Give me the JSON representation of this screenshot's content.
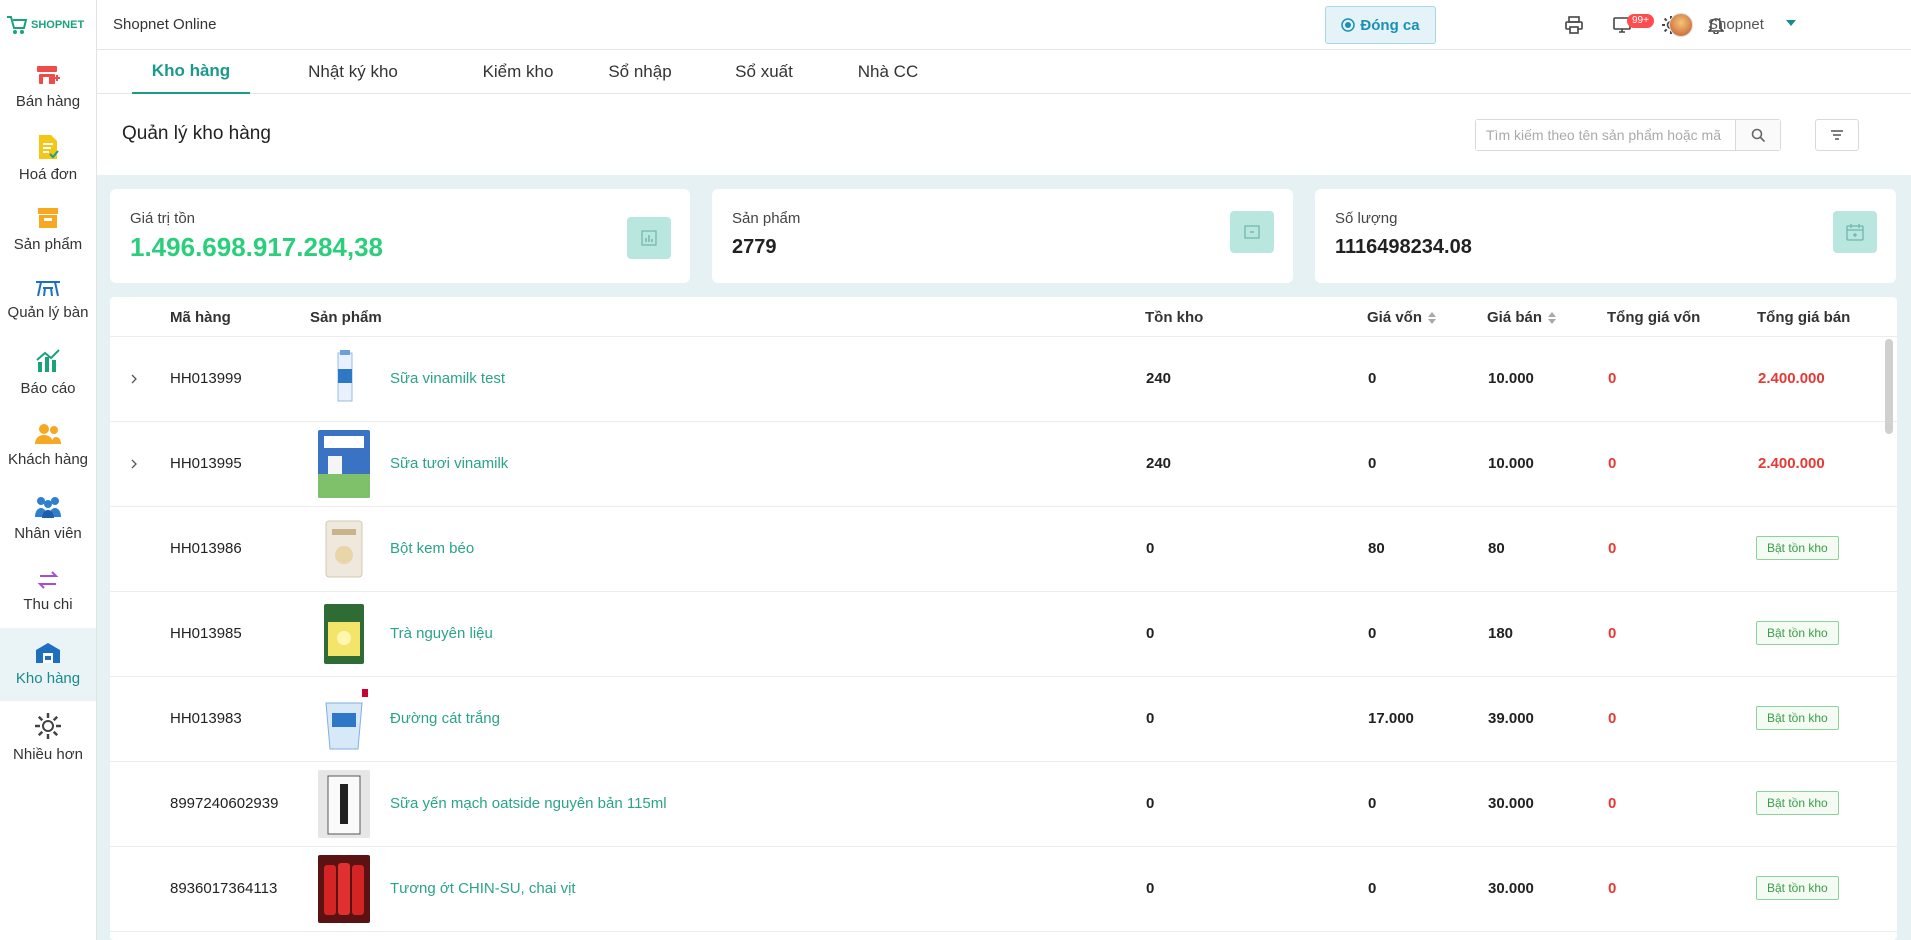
{
  "app": {
    "logo_text": "SHOPNET",
    "title": "Shopnet Online"
  },
  "topbar": {
    "dong_ca_label": "Đóng ca",
    "notification_count": "99+",
    "user_name": "Shopnet"
  },
  "sidebar": {
    "items": [
      {
        "label": "Bán hàng",
        "icon": "cart-plus-icon"
      },
      {
        "label": "Hoá đơn",
        "icon": "invoice-icon"
      },
      {
        "label": "Sản phẩm",
        "icon": "box-icon"
      },
      {
        "label": "Quản lý bàn",
        "icon": "table-icon"
      },
      {
        "label": "Báo cáo",
        "icon": "chart-icon"
      },
      {
        "label": "Khách hàng",
        "icon": "customers-icon"
      },
      {
        "label": "Nhân viên",
        "icon": "staff-icon"
      },
      {
        "label": "Thu chi",
        "icon": "transfer-icon"
      },
      {
        "label": "Kho hàng",
        "icon": "warehouse-icon"
      },
      {
        "label": "Nhiều hơn",
        "icon": "gear-icon"
      }
    ]
  },
  "tabs": [
    {
      "label": "Kho hàng"
    },
    {
      "label": "Nhật ký kho"
    },
    {
      "label": "Kiểm kho"
    },
    {
      "label": "Sổ nhập"
    },
    {
      "label": "Sổ xuất"
    },
    {
      "label": "Nhà CC"
    }
  ],
  "page": {
    "title": "Quản lý kho hàng",
    "search_placeholder": "Tìm kiếm theo tên sản phẩm hoặc mã"
  },
  "summary": {
    "gia_tri_ton_label": "Giá trị tồn",
    "gia_tri_ton_value": "1.496.698.917.284,38",
    "san_pham_label": "Sản phẩm",
    "san_pham_value": "2779",
    "so_luong_label": "Số lượng",
    "so_luong_value": "1116498234.08"
  },
  "table": {
    "headers": {
      "ma_hang": "Mã hàng",
      "san_pham": "Sản phẩm",
      "ton_kho": "Tồn kho",
      "gia_von": "Giá vốn",
      "gia_ban": "Giá bán",
      "tong_gia_von": "Tổng giá vốn",
      "tong_gia_ban": "Tổng giá bán"
    },
    "toggle_label": "Bật tồn kho",
    "rows": [
      {
        "code": "HH013999",
        "name": "Sữa vinamilk test",
        "ton": "240",
        "gv": "0",
        "gb": "10.000",
        "tgv": "0",
        "tgb": "2.400.000"
      },
      {
        "code": "HH013995",
        "name": "Sữa tươi vinamilk",
        "ton": "240",
        "gv": "0",
        "gb": "10.000",
        "tgv": "0",
        "tgb": "2.400.000"
      },
      {
        "code": "HH013986",
        "name": "Bột kem béo",
        "ton": "0",
        "gv": "80",
        "gb": "80",
        "tgv": "0",
        "tgb": ""
      },
      {
        "code": "HH013985",
        "name": "Trà nguyên liệu",
        "ton": "0",
        "gv": "0",
        "gb": "180",
        "tgv": "0",
        "tgb": ""
      },
      {
        "code": "HH013983",
        "name": "Đường cát trắng",
        "ton": "0",
        "gv": "17.000",
        "gb": "39.000",
        "tgv": "0",
        "tgb": ""
      },
      {
        "code": "8997240602939",
        "name": "Sữa yến mạch oatside nguyên bản 115ml",
        "ton": "0",
        "gv": "0",
        "gb": "30.000",
        "tgv": "0",
        "tgb": ""
      },
      {
        "code": "8936017364113",
        "name": "Tương ớt CHIN-SU, chai vịt",
        "ton": "0",
        "gv": "0",
        "gb": "30.000",
        "tgv": "0",
        "tgb": ""
      }
    ]
  }
}
